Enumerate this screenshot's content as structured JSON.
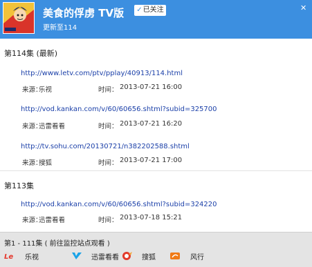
{
  "header": {
    "title": "美食的俘虏 TV版",
    "follow_label": "已关注",
    "subtitle": "更新至114",
    "close_label": "✕",
    "accent": "#3c8fe0"
  },
  "episodes": [
    {
      "title": "第114集 (最新)",
      "sources": [
        {
          "url": "http://www.letv.com/ptv/pplay/40913/114.html",
          "source_label": "来源：",
          "source": "乐视",
          "time_label": "时间：",
          "time": "2013-07-21 16:00"
        },
        {
          "url": "http://vod.kankan.com/v/60/60656.shtml?subid=325700",
          "source_label": "来源：",
          "source": "迅雷看看",
          "time_label": "时间：",
          "time": "2013-07-21 16:20"
        },
        {
          "url": "http://tv.sohu.com/20130721/n382202588.shtml",
          "source_label": "来源：",
          "source": "搜狐",
          "time_label": "时间：",
          "time": "2013-07-21 17:00"
        }
      ]
    },
    {
      "title": "第113集",
      "sources": [
        {
          "url": "http://vod.kankan.com/v/60/60656.shtml?subid=324220",
          "source_label": "来源：",
          "source": "迅雷看看",
          "time_label": "时间：",
          "time": "2013-07-18 15:21"
        }
      ]
    }
  ],
  "footer": {
    "title": "第1 - 111集 ( 前往监控站点观看 )",
    "sites": [
      {
        "name": "乐视",
        "icon": "letv-icon",
        "color": "#e4382d"
      },
      {
        "name": "迅雷看看",
        "icon": "kankan-icon",
        "color": "#1aa3e8"
      },
      {
        "name": "搜狐",
        "icon": "sohu-icon",
        "color": "#e23a2b"
      },
      {
        "name": "风行",
        "icon": "funshion-icon",
        "color": "#f07a16"
      }
    ]
  }
}
